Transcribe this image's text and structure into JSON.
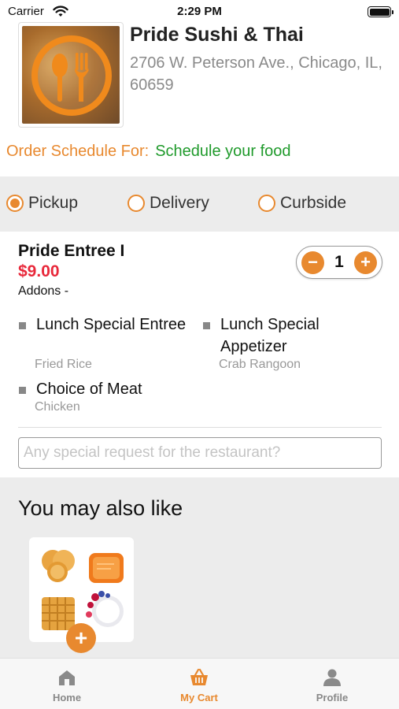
{
  "status_bar": {
    "carrier": "Carrier",
    "time": "2:29 PM"
  },
  "restaurant": {
    "name": "Pride Sushi & Thai",
    "address": "2706 W. Peterson Ave., Chicago, IL, 60659",
    "logo_icon": "fork-spoon-icon"
  },
  "schedule": {
    "label": "Order Schedule For:",
    "value": "Schedule your food"
  },
  "order_types": [
    {
      "label": "Pickup",
      "selected": true
    },
    {
      "label": "Delivery",
      "selected": false
    },
    {
      "label": "Curbside",
      "selected": false
    }
  ],
  "cart_item": {
    "name": "Pride Entree I",
    "price": "$9.00",
    "addons_label": "Addons -",
    "quantity": "1",
    "minus_label": "−",
    "plus_label": "+",
    "addons": [
      {
        "title": "Lunch Special Entree",
        "choice": "Fried Rice"
      },
      {
        "title": "Lunch Special Appetizer",
        "choice": "Crab Rangoon"
      },
      {
        "title": "Choice of Meat",
        "choice": "Chicken"
      }
    ]
  },
  "special_request": {
    "placeholder": "Any special request for the restaurant?",
    "value": ""
  },
  "recommendations": {
    "title": "You may also like",
    "items": [
      {
        "image_icon": "breakfast-food-icon",
        "add_label": "+"
      }
    ]
  },
  "tab_bar": {
    "tabs": [
      {
        "label": "Home",
        "icon": "home-icon",
        "active": false
      },
      {
        "label": "My Cart",
        "icon": "basket-icon",
        "active": true
      },
      {
        "label": "Profile",
        "icon": "person-icon",
        "active": false
      }
    ]
  },
  "colors": {
    "accent": "#e8892f",
    "price": "#e8283a",
    "schedule_value": "#1f9a2b",
    "section_bg": "#ececec"
  }
}
